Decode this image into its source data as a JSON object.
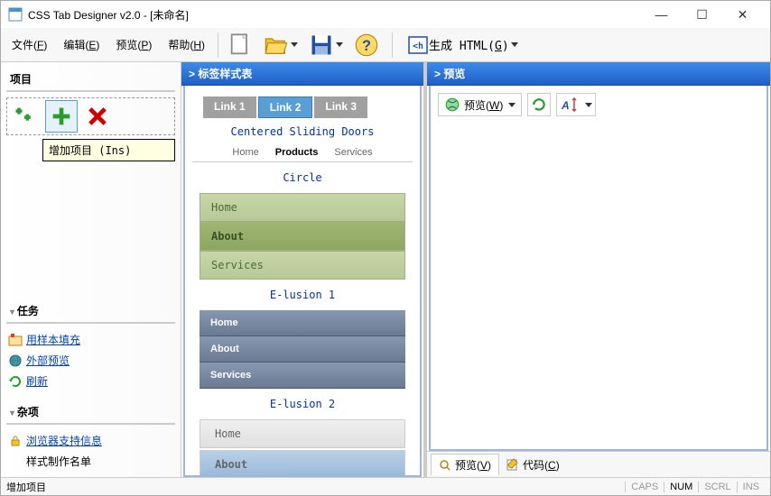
{
  "title": "CSS Tab Designer v2.0 - [未命名]",
  "menu": {
    "file": "文件(F)",
    "edit": "编辑(E)",
    "preview": "预览(P)",
    "help": "帮助(H)"
  },
  "toolbar": {
    "generate": "生成 HTML(G)"
  },
  "left": {
    "items_header": "项目",
    "tooltip": "增加项目 (Ins)",
    "tasks_header": "任务",
    "tasks": {
      "fill_sample": "用样本填充",
      "external_preview": "外部预览",
      "refresh": "刷新"
    },
    "misc_header": "杂项",
    "misc": {
      "browser_support": "浏览器支持信息",
      "credits": "样式制作名单"
    }
  },
  "center": {
    "title": "> 标签样式表",
    "link_tabs": [
      "Link 1",
      "Link 2",
      "Link 3"
    ],
    "styles": {
      "csd": {
        "label": "Centered Sliding Doors",
        "tabs": [
          "Home",
          "Products",
          "Services"
        ]
      },
      "circle": {
        "label": "Circle",
        "items": [
          "Home",
          "About",
          "Services"
        ]
      },
      "elusion1": {
        "label": "E-lusion 1",
        "items": [
          "Home",
          "About",
          "Services"
        ]
      },
      "elusion2": {
        "label": "E-lusion 2",
        "items": [
          "Home",
          "About"
        ]
      }
    }
  },
  "right": {
    "title": "> 预览",
    "preview_btn": "预览(W)",
    "tabs": {
      "preview": "预览(V)",
      "code": "代码(C)"
    }
  },
  "statusbar": {
    "text": "增加项目",
    "indicators": [
      "CAPS",
      "NUM",
      "SCRL",
      "INS"
    ]
  }
}
